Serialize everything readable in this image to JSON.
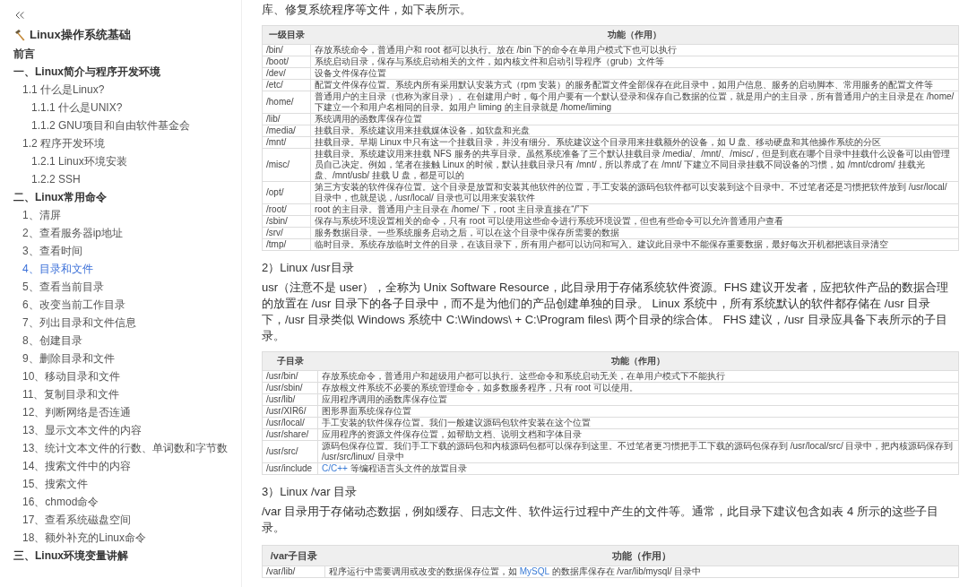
{
  "sidebar": {
    "title": "Linux操作系统基础",
    "items": [
      {
        "label": "前言",
        "selected": false
      },
      {
        "label": "一、Linux简介与程序开发环境",
        "selected": false,
        "children": [
          {
            "label": "1.1 什么是Linux?",
            "selected": false,
            "children": [
              {
                "label": "1.1.1 什么是UNIX?",
                "selected": false
              },
              {
                "label": "1.1.2 GNU项目和自由软件基金会",
                "selected": false
              }
            ]
          },
          {
            "label": "1.2 程序开发环境",
            "selected": false,
            "children": [
              {
                "label": "1.2.1 Linux环境安装",
                "selected": false
              },
              {
                "label": "1.2.2 SSH",
                "selected": false
              }
            ]
          }
        ]
      },
      {
        "label": "二、Linux常用命令",
        "selected": false,
        "children": [
          {
            "label": "1、清屏",
            "selected": false
          },
          {
            "label": "2、查看服务器ip地址",
            "selected": false
          },
          {
            "label": "3、查看时间",
            "selected": false
          },
          {
            "label": "4、目录和文件",
            "selected": true
          },
          {
            "label": "5、查看当前目录",
            "selected": false
          },
          {
            "label": "6、改变当前工作目录",
            "selected": false
          },
          {
            "label": "7、列出目录和文件信息",
            "selected": false
          },
          {
            "label": "8、创建目录",
            "selected": false
          },
          {
            "label": "9、删除目录和文件",
            "selected": false
          },
          {
            "label": "10、移动目录和文件",
            "selected": false
          },
          {
            "label": "11、复制目录和文件",
            "selected": false
          },
          {
            "label": "12、判断网络是否连通",
            "selected": false
          },
          {
            "label": "13、显示文本文件的内容",
            "selected": false
          },
          {
            "label": "13、统计文本文件的行数、单词数和字节数",
            "selected": false
          },
          {
            "label": "14、搜索文件中的内容",
            "selected": false
          },
          {
            "label": "15、搜索文件",
            "selected": false
          },
          {
            "label": "16、chmod命令",
            "selected": false
          },
          {
            "label": "17、查看系统磁盘空间",
            "selected": false
          },
          {
            "label": "18、额外补充的Linux命令",
            "selected": false
          }
        ]
      },
      {
        "label": "三、Linux环境变量讲解",
        "selected": false
      }
    ]
  },
  "article": [
    {
      "kind": "paragraph",
      "text": "库、修复系统程序等文件，如下表所示。"
    },
    {
      "kind": "table",
      "columns": [
        "一级目录",
        "功能（作用）"
      ],
      "rows": [
        [
          "/bin/",
          "存放系统命令，普通用户和 root 都可以执行。放在 /bin 下的命令在单用户模式下也可以执行"
        ],
        [
          "/boot/",
          "系统启动目录，保存与系统启动相关的文件，如内核文件和启动引导程序（grub）文件等"
        ],
        [
          "/dev/",
          "设备文件保存位置"
        ],
        [
          "/etc/",
          "配置文件保存位置。系统内所有采用默认安装方式（rpm 安装）的服务配置文件全部保存在此目录中，如用户信息、服务的启动脚本、常用服务的配置文件等"
        ],
        [
          "/home/",
          "普通用户的主目录（也称为家目录）。在创建用户时，每个用户要有一个默认登录和保存自己数据的位置，就是用户的主目录，所有普通用户的主目录是在 /home/ 下建立一个和用户名相同的目录。如用户 liming 的主目录就是 /home/liming"
        ],
        [
          "/lib/",
          "系统调用的函数库保存位置"
        ],
        [
          "/media/",
          "挂载目录。系统建议用来挂载媒体设备，如软盘和光盘"
        ],
        [
          "/mnt/",
          "挂载目录。早期 Linux 中只有这一个挂载目录，并没有细分。系统建议这个目录用来挂载额外的设备，如 U 盘、移动硬盘和其他操作系统的分区"
        ],
        [
          "/misc/",
          "挂载目录。系统建议用来挂载 NFS 服务的共享目录。虽然系统准备了三个默认挂载目录 /media/、/mnt/、/misc/，但是到底在哪个目录中挂载什么设备可以由管理员自己决定。例如，笔者在接触 Linux 的时候，默认挂载目录只有 /mnt/，所以养成了在 /mnt/ 下建立不同目录挂载不同设备的习惯，如 /mnt/cdrom/ 挂载光盘、/mnt/usb/ 挂载 U 盘，都是可以的"
        ],
        [
          "/opt/",
          "第三方安装的软件保存位置。这个目录是放置和安装其他软件的位置，手工安装的源码包软件都可以安装到这个目录中。不过笔者还是习惯把软件放到 /usr/local/ 目录中，也就是说，/usr/local/ 目录也可以用来安装软件"
        ],
        [
          "/root/",
          "root 的主目录。普通用户主目录在 /home/ 下，root 主目录直接在“/”下"
        ],
        [
          "/sbin/",
          "保存与系统环境设置相关的命令，只有 root 可以使用这些命令进行系统环境设置，但也有些命令可以允许普通用户查看"
        ],
        [
          "/srv/",
          "服务数据目录。一些系统服务启动之后，可以在这个目录中保存所需要的数据"
        ],
        [
          "/tmp/",
          "临时目录。系统存放临时文件的目录，在该目录下，所有用户都可以访问和写入。建议此目录中不能保存重要数据，最好每次开机都把该目录清空"
        ]
      ]
    },
    {
      "kind": "heading",
      "text": "2）Linux /usr目录"
    },
    {
      "kind": "paragraph",
      "text": "usr（注意不是 user），全称为 Unix Software Resource，此目录用于存储系统软件资源。FHS 建议开发者，应把软件产品的数据合理的放置在 /usr 目录下的各子目录中，而不是为他们的产品创建单独的目录。 Linux 系统中，所有系统默认的软件都存储在 /usr 目录下，/usr 目录类似 Windows 系统中 C:\\Windows\\ + C:\\Program files\\ 两个目录的综合体。 FHS 建议，/usr 目录应具备下表所示的子目录。"
    },
    {
      "kind": "table",
      "columns": [
        "子目录",
        "功能（作用）"
      ],
      "rows": [
        [
          "/usr/bin/",
          "存放系统命令，普通用户和超级用户都可以执行。这些命令和系统启动无关，在单用户模式下不能执行"
        ],
        [
          "/usr/sbin/",
          "存放根文件系统不必要的系统管理命令，如多数服务程序，只有 root 可以使用。"
        ],
        [
          "/usr/lib/",
          "应用程序调用的函数库保存位置"
        ],
        [
          "/usr/XIR6/",
          "图形界面系统保存位置"
        ],
        [
          "/usr/local/",
          "手工安装的软件保存位置。我们一般建议源码包软件安装在这个位置"
        ],
        [
          "/usr/share/",
          "应用程序的资源文件保存位置，如帮助文档、说明文档和字体目录"
        ],
        [
          "/usr/src/",
          "源码包保存位置。我们手工下载的源码包和内核源码包都可以保存到这里。不过笔者更习惯把手工下载的源码包保存到 /usr/local/src/ 目录中，把内核源码保存到 /usr/src/linux/ 目录中"
        ],
        [
          "/usr/include",
          [
            {
              "kind": "link",
              "text": "C/C++"
            },
            {
              "kind": "plain",
              "text": " 等编程语言头文件的放置目录"
            }
          ]
        ]
      ]
    },
    {
      "kind": "heading",
      "text": "3）Linux /var 目录"
    },
    {
      "kind": "paragraph",
      "text": "/var 目录用于存储动态数据，例如缓存、日志文件、软件运行过程中产生的文件等。通常，此目录下建议包含如表 4 所示的这些子目录。"
    },
    {
      "kind": "table",
      "columns": [
        "/var子目录",
        "功能（作用）"
      ],
      "rows": [
        [
          "/var/lib/",
          [
            {
              "kind": "plain",
              "text": "程序运行中需要调用或改变的数据保存位置，如 "
            },
            {
              "kind": "link",
              "text": "MySQL"
            },
            {
              "kind": "plain",
              "text": " 的数据库保存在 /var/lib/mysql/ 目录中"
            }
          ]
        ]
      ]
    }
  ]
}
